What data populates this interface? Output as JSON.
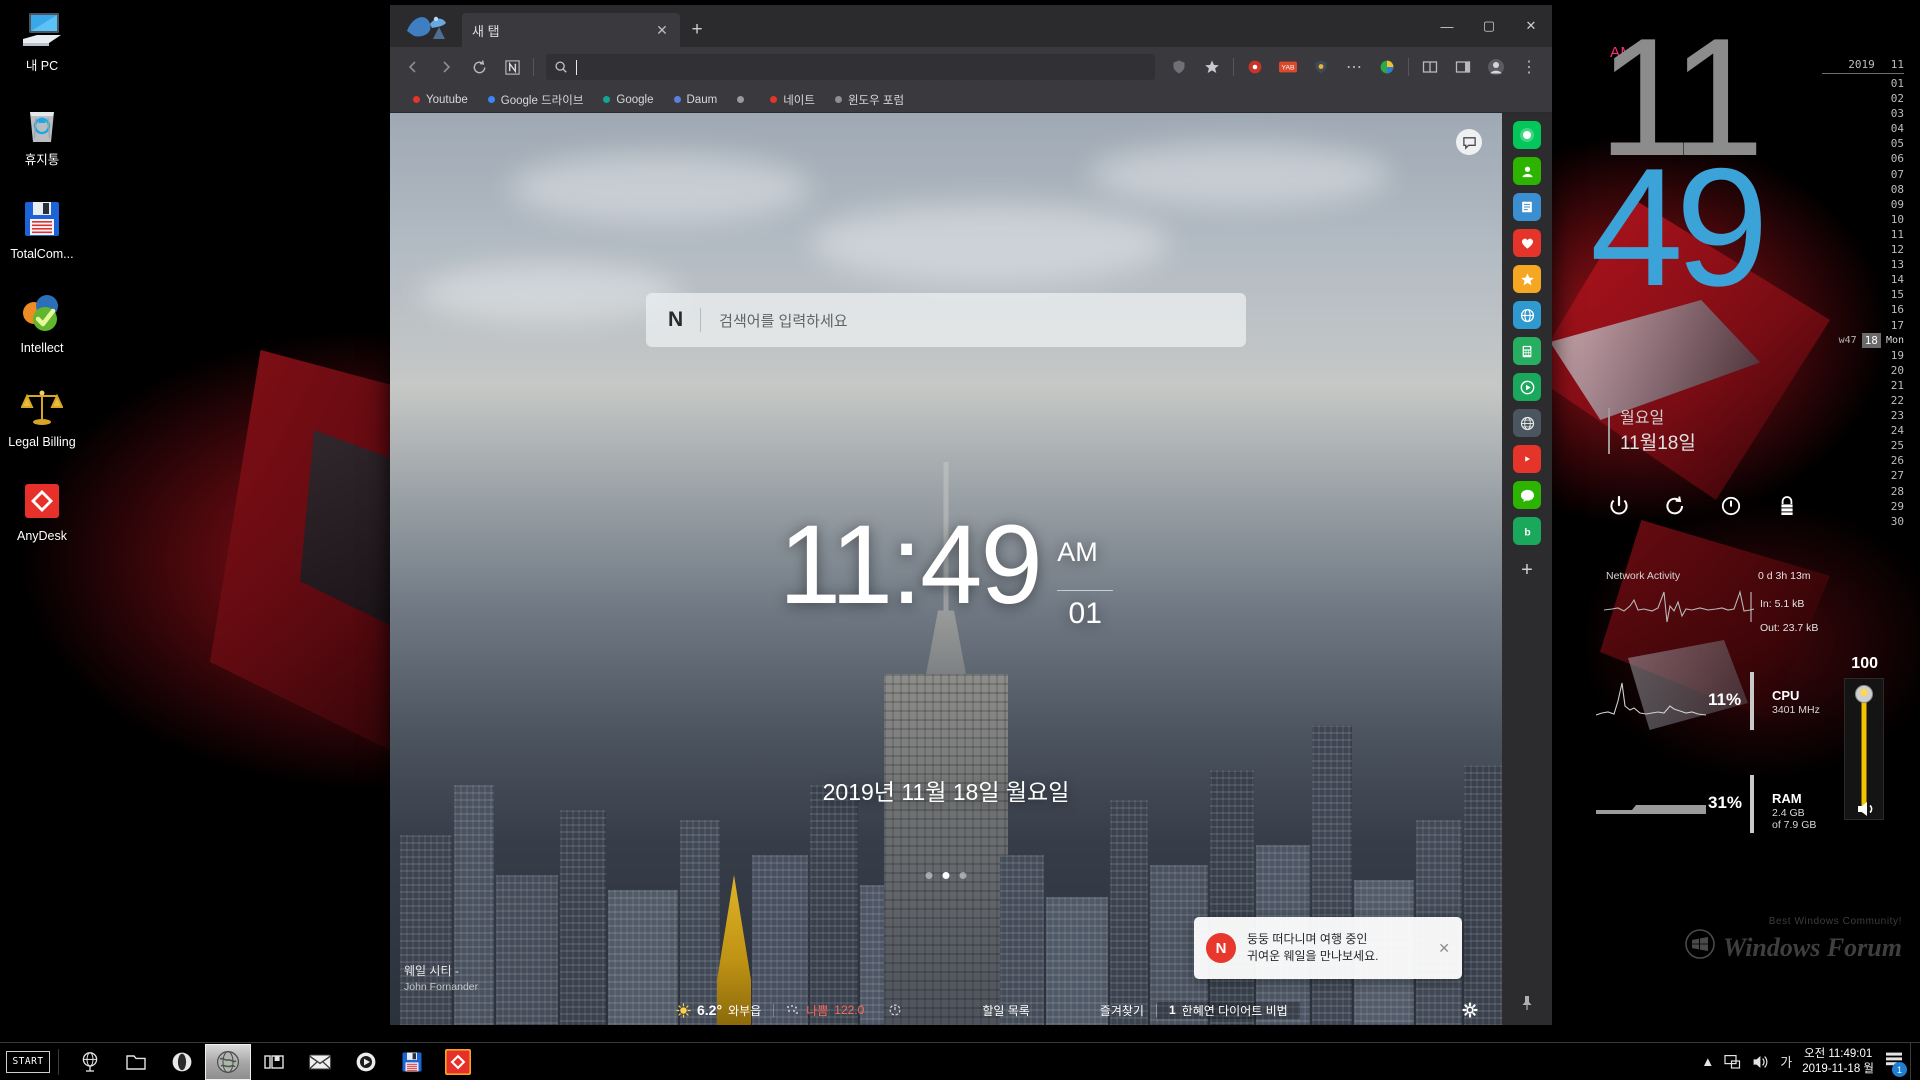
{
  "desktop": {
    "icons": [
      {
        "label": "내 PC",
        "icon": "computer-icon"
      },
      {
        "label": "휴지통",
        "icon": "recycle-bin-icon"
      },
      {
        "label": "TotalCom...",
        "icon": "floppy-disk-icon"
      },
      {
        "label": "Intellect",
        "icon": "check-circles-icon"
      },
      {
        "label": "Legal Billing",
        "icon": "scales-icon"
      },
      {
        "label": "AnyDesk",
        "icon": "anydesk-icon"
      }
    ]
  },
  "browser": {
    "tab": {
      "title": "새 탭",
      "close_label": "✕"
    },
    "newtab_label": "+",
    "window_controls": {
      "minimize": "—",
      "maximize": "▢",
      "close": "✕"
    },
    "toolbar": {
      "back": "‹",
      "forward": "›",
      "reload": "⟳",
      "naver_badge": "N",
      "search_icon": "search-icon",
      "omnibox_value": "",
      "omnibox_placeholder": "",
      "shield": "shield-icon",
      "star": "star-icon",
      "ext_yab": "YAB",
      "more": "⋯",
      "split": "split-screen-icon",
      "sidebar": "sidebar-icon",
      "profile": "profile-icon",
      "menu": "⋮"
    },
    "bookmarks": [
      {
        "label": "Youtube",
        "color": "#e5342a"
      },
      {
        "label": "Google 드라이브",
        "color": "#3b86f7"
      },
      {
        "label": "Google",
        "color": "#12a594"
      },
      {
        "label": "Daum",
        "color": "#5b7fe0"
      },
      {
        "label": "",
        "color": "#9b9b9b"
      },
      {
        "label": "네이트",
        "color": "#e5342a"
      },
      {
        "label": "윈도우 포럼",
        "color": "#8e8e93"
      }
    ]
  },
  "newtab": {
    "search": {
      "logo": "N",
      "placeholder": "검색어를 입력하세요"
    },
    "clock": {
      "time": "11:49",
      "ampm": "AM",
      "seconds": "01"
    },
    "date": "2019년 11월 18일 월요일",
    "photo_credit": {
      "title": "웨일 시티 -",
      "author": "John Fornander"
    },
    "carousel_dots": 3,
    "carousel_active": 1,
    "chat_icon": "chat-bubble-icon",
    "statusbar": {
      "weather_icon": "sun-icon",
      "temperature": "6.2°",
      "location": "와부읍",
      "dust_icon": "dust-icon",
      "dust_level": "나쁨",
      "dust_value": "122.0",
      "refresh_icon": "refresh-icon",
      "todo": "할일 목록",
      "favorites": "즐겨찾기",
      "rank_no": "1",
      "rank_text": "한혜연 다이어트 비법",
      "settings_icon": "gear-icon"
    },
    "toast": {
      "badge": "N",
      "line1": "둥둥 떠다니며 여행 중인",
      "line2": "귀여운 웨일을 만나보세요.",
      "close": "✕"
    }
  },
  "whale_sidebar": {
    "items": [
      {
        "name": "naver-whale-icon",
        "color": "#03c75a",
        "glyph": "◉"
      },
      {
        "name": "contacts-icon",
        "color": "#2db400",
        "glyph": "☻"
      },
      {
        "name": "notes-icon",
        "color": "#3b8ed0",
        "glyph": "▤"
      },
      {
        "name": "shopping-icon",
        "color": "#e5342a",
        "glyph": "♥"
      },
      {
        "name": "bookmarks-star-icon",
        "color": "#f5a623",
        "glyph": "★"
      },
      {
        "name": "translate-icon",
        "color": "#2f9ad0",
        "glyph": "㉿"
      },
      {
        "name": "calculator-icon",
        "color": "#27ae60",
        "glyph": "▦"
      },
      {
        "name": "media-player-icon",
        "color": "#1aa85c",
        "glyph": "▶"
      },
      {
        "name": "globe-icon",
        "color": "#4a5560",
        "glyph": "◍"
      },
      {
        "name": "youtube-icon",
        "color": "#e5342a",
        "glyph": "▶"
      },
      {
        "name": "messenger-icon",
        "color": "#2db400",
        "glyph": "✆"
      },
      {
        "name": "band-icon",
        "color": "#1aa85c",
        "glyph": "b"
      }
    ],
    "add_label": "+",
    "pin_icon": "pin-icon"
  },
  "rainmeter": {
    "ampm": "AM",
    "hour": "11",
    "minute": "49",
    "day_of_week": "월요일",
    "date_label": "11월18일",
    "calendar": {
      "year": "2019",
      "month": "11",
      "today": "18",
      "week_label": "w47",
      "today_dow": "Mon",
      "days": [
        "01",
        "02",
        "03",
        "04",
        "05",
        "06",
        "07",
        "08",
        "09",
        "10",
        "11",
        "12",
        "13",
        "14",
        "15",
        "16",
        "17",
        "18",
        "19",
        "20",
        "21",
        "22",
        "23",
        "24",
        "25",
        "26",
        "27",
        "28",
        "29",
        "30"
      ]
    },
    "power_buttons": [
      {
        "name": "shutdown-icon",
        "glyph": "⏻"
      },
      {
        "name": "restart-icon",
        "glyph": "⟳"
      },
      {
        "name": "sleep-icon",
        "glyph": "⏼"
      },
      {
        "name": "lock-icon",
        "glyph": "🔒"
      }
    ],
    "network": {
      "title": "Network Activity",
      "uptime": "0 d 3h 13m",
      "in": "In: 5.1 kB",
      "out": "Out: 23.7 kB"
    },
    "cpu": {
      "percent": "11%",
      "name": "CPU",
      "detail": "3401 MHz"
    },
    "ram": {
      "percent": "31%",
      "name": "RAM",
      "detail_line1": "2.4 GB",
      "detail_line2": "of 7.9 GB"
    },
    "volume": {
      "value": "100",
      "speaker_icon": "speaker-icon"
    },
    "watermark": {
      "sub": "Best Windows Community!",
      "main": "Windows Forum",
      "logo": "windows-logo-icon"
    }
  },
  "taskbar": {
    "start_label": "START",
    "apps": [
      {
        "name": "taskbar-globe-icon",
        "glyph": "globe"
      },
      {
        "name": "taskbar-folder-icon",
        "glyph": "folder"
      },
      {
        "name": "taskbar-opera-icon",
        "glyph": "opera"
      },
      {
        "name": "taskbar-browser-icon",
        "glyph": "world",
        "active": true
      },
      {
        "name": "taskbar-explorer-icon",
        "glyph": "explorer"
      },
      {
        "name": "taskbar-mail-icon",
        "glyph": "mail"
      },
      {
        "name": "taskbar-player-icon",
        "glyph": "player"
      },
      {
        "name": "taskbar-totalcmd-icon",
        "glyph": "floppy"
      },
      {
        "name": "taskbar-anydesk-icon",
        "glyph": "anydesk"
      }
    ],
    "tray": {
      "chevron": "▲",
      "network_icon": "network-icon",
      "volume_icon": "volume-icon",
      "ime_label": "가",
      "clock_line1": "오전 11:49:01",
      "clock_line2": "2019-11-18 월",
      "action_center_icon": "action-center-icon",
      "notification_count": "1"
    }
  }
}
